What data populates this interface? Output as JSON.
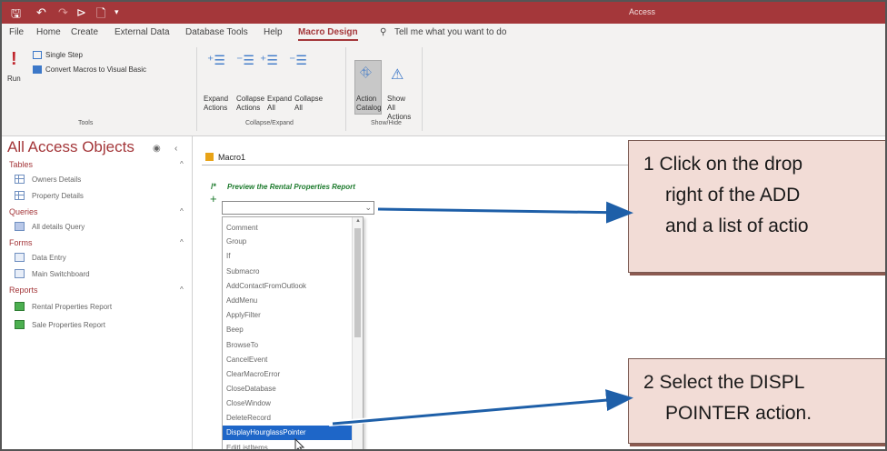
{
  "titlebar": {
    "quick_access": [
      "🖫",
      "↶",
      "↷",
      "⊳",
      "🗋",
      "▾"
    ],
    "title": "Access"
  },
  "menu": {
    "tabs": [
      "File",
      "Home",
      "Create",
      "External Data",
      "Database Tools",
      "Help",
      "Macro Design"
    ],
    "active_tab": "Macro Design",
    "tell_me": "Tell me what you want to do"
  },
  "ribbon": {
    "run_label": "Run",
    "single_step": "Single Step",
    "convert_macros": "Convert Macros to Visual Basic",
    "tools_label": "Tools",
    "expand_actions": "Expand Actions",
    "collapse_actions": "Collapse Actions",
    "expand_all": "Expand All",
    "collapse_all": "Collapse All",
    "collapse_expand_label": "Collapse/Expand",
    "action_catalog": "Action Catalog",
    "show_all_actions": "Show All Actions",
    "show_hide_label": "Show/Hide"
  },
  "nav": {
    "title": "All Access Objects",
    "sections": [
      {
        "label": "Tables",
        "items": [
          "Owners Details",
          "Property Details"
        ]
      },
      {
        "label": "Queries",
        "items": [
          "All details Query"
        ]
      },
      {
        "label": "Forms",
        "items": [
          "Data Entry",
          "Main Switchboard"
        ]
      },
      {
        "label": "Reports",
        "items": [
          "Rental Properties Report",
          "Sale Properties Report"
        ]
      }
    ]
  },
  "macro": {
    "tab_label": "Macro1",
    "comment_marker": "/*",
    "comment": "Preview the Rental Properties Report",
    "add_action_value": "",
    "actions": [
      "Comment",
      "Group",
      "If",
      "Submacro",
      "AddContactFromOutlook",
      "AddMenu",
      "ApplyFilter",
      "Beep",
      "BrowseTo",
      "CancelEvent",
      "ClearMacroError",
      "CloseDatabase",
      "CloseWindow",
      "DeleteRecord",
      "DisplayHourglassPointer",
      "EditListItems"
    ],
    "selected_action": "DisplayHourglassPointer"
  },
  "callouts": [
    {
      "number": "1",
      "lines": [
        "1  Click on the drop",
        "right of the ADD",
        "and a list of actio"
      ]
    },
    {
      "number": "2",
      "lines": [
        "2  Select the DISPL",
        "POINTER action."
      ]
    }
  ],
  "colors": {
    "accent": "#a4373a",
    "callout_fill": "#f2dcd6",
    "arrow": "#1e5fa8",
    "selection": "#1e66c8"
  }
}
